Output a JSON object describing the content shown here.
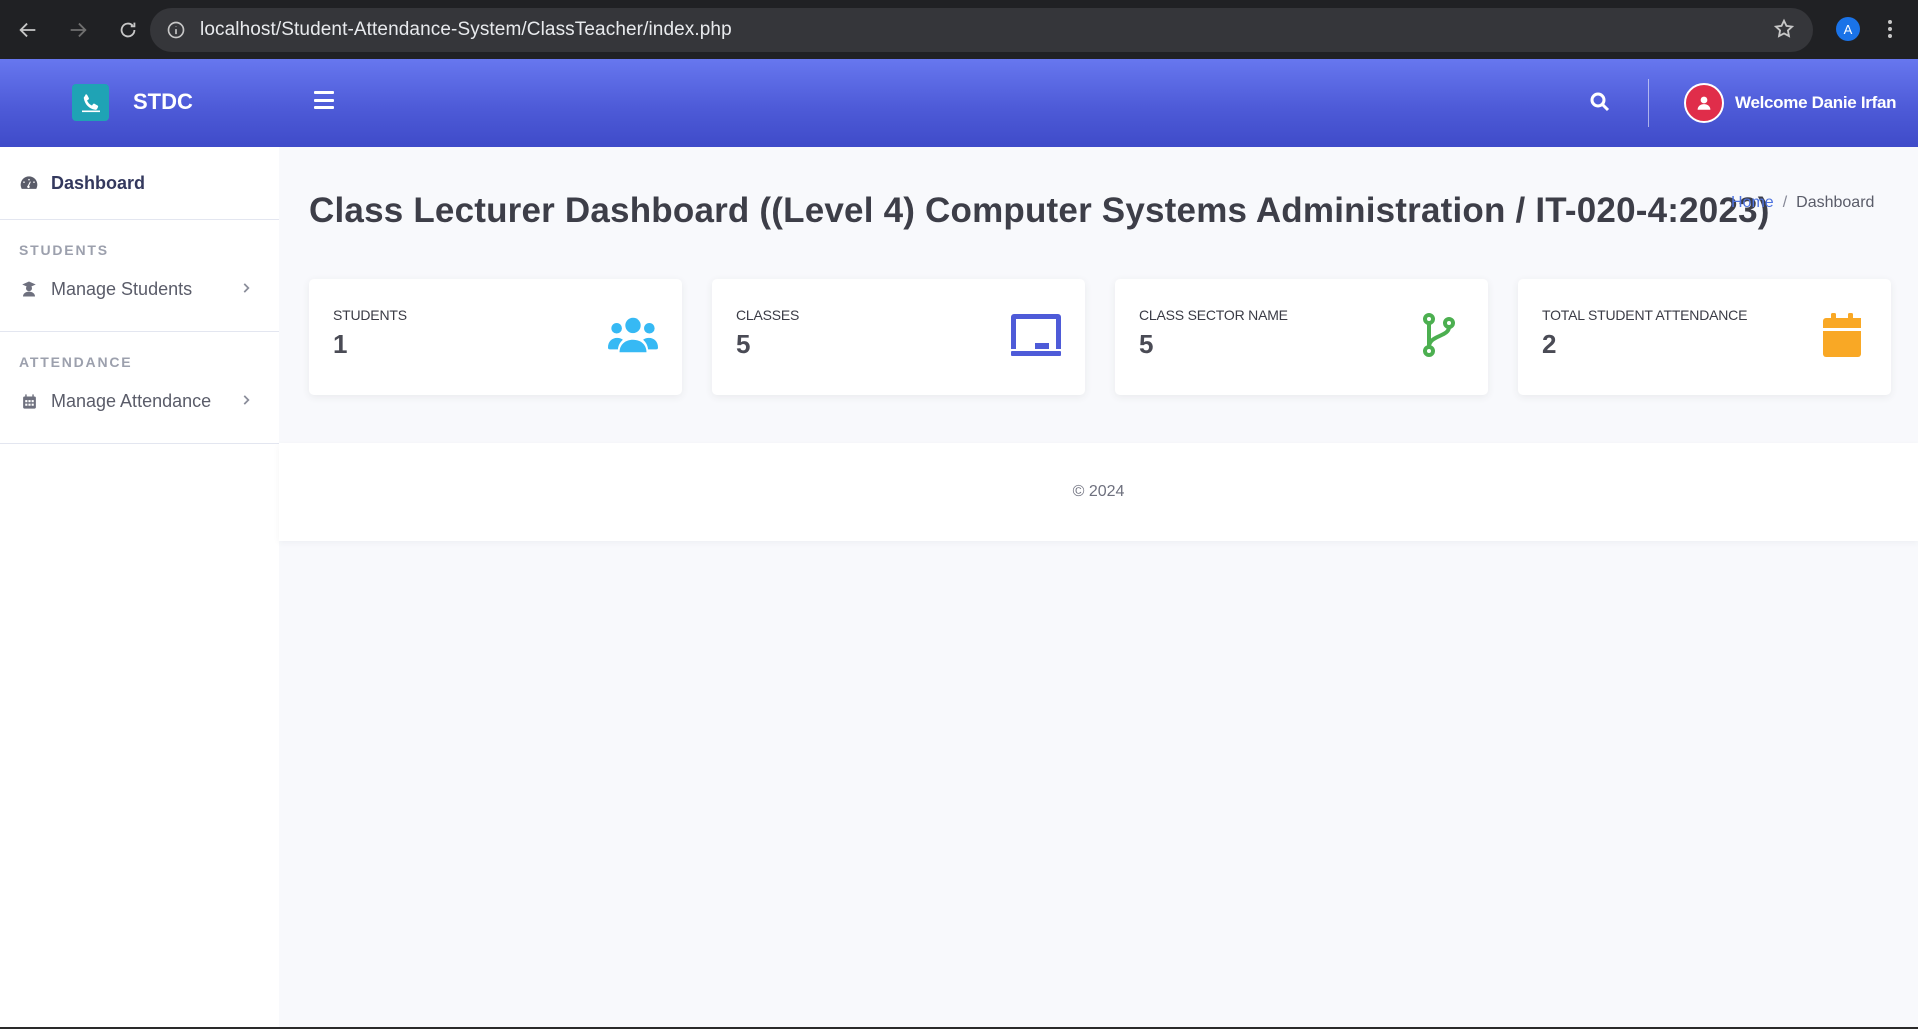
{
  "browser": {
    "url": "localhost/Student-Attendance-System/ClassTeacher/index.php",
    "profile_initial": "A"
  },
  "topbar": {
    "brand": "STDC",
    "welcome": "Welcome Danie Irfan",
    "colors": {
      "gradient_top": "#6777ef",
      "gradient_bottom": "#3f4bc9",
      "avatar": "#e02d4a"
    }
  },
  "sidebar": {
    "dashboard_label": "Dashboard",
    "students_heading": "STUDENTS",
    "manage_students_label": "Manage Students",
    "attendance_heading": "ATTENDANCE",
    "manage_attendance_label": "Manage Attendance"
  },
  "main": {
    "title": "Class Lecturer Dashboard ((Level 4) Computer Systems Administration / IT-020-4:2023)",
    "breadcrumb": {
      "home": "Home",
      "separator": "/",
      "current": "Dashboard"
    },
    "cards": [
      {
        "label": "Students",
        "value": "1",
        "icon": "users-icon",
        "color": "#36b9f4"
      },
      {
        "label": "Classes",
        "value": "5",
        "icon": "chalkboard-icon",
        "color": "#4e5bd8"
      },
      {
        "label": "Class Sector Name",
        "value": "5",
        "icon": "code-branch-icon",
        "color": "#4caf50"
      },
      {
        "label": "Total Student Attendance",
        "value": "2",
        "icon": "calendar-icon",
        "color": "#f9a825"
      }
    ]
  },
  "footer": {
    "text": "© 2024"
  }
}
